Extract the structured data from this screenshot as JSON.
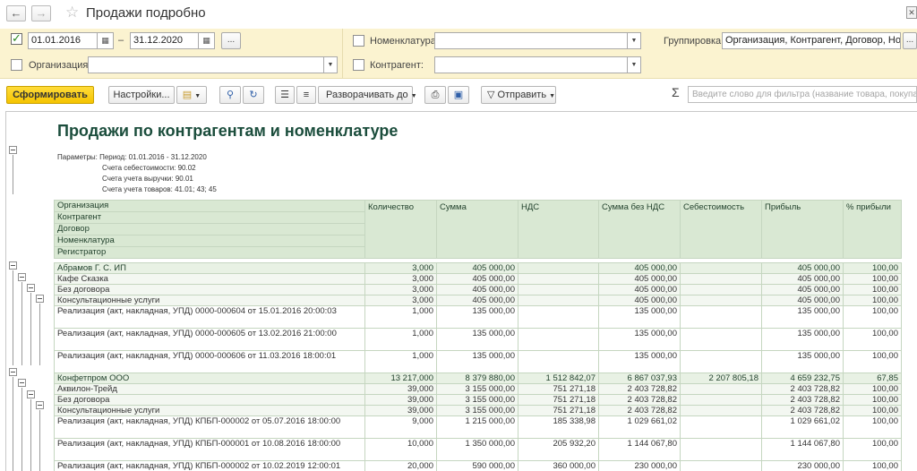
{
  "window": {
    "title": "Продажи подробно",
    "back_icon": "arrow-left",
    "forward_icon": "arrow-right",
    "favorite_icon": "star",
    "close_icon": "close"
  },
  "filters": {
    "period_from": "01.01.2016",
    "period_dash": "–",
    "period_to": "31.12.2020",
    "period_checked": true,
    "more_button": "...",
    "organization_label": "Организация:",
    "organization_value": "",
    "nomenclature_label": "Номенклатура:",
    "nomenclature_value": "",
    "counterparty_label": "Контрагент:",
    "counterparty_value": "",
    "grouping_label": "Группировка:",
    "grouping_value": "Организация, Контрагент, Договор, Номенклатура",
    "grouping_button": "..."
  },
  "toolbar": {
    "generate": "Сформировать",
    "settings": "Настройки...",
    "expand": "Разворачивать до",
    "send": "Отправить",
    "sigma": "Σ",
    "search_placeholder": "Введите слово для фильтра (название товара, покупателя)"
  },
  "report": {
    "title": "Продажи по контрагентам и номенклатуре",
    "params": [
      "Параметры: Период: 01.01.2016 - 31.12.2020",
      "Счета себестоимости: 90.02",
      "Счета учета выручки: 90.01",
      "Счета учета товаров: 41.01; 43; 45"
    ],
    "group_headers": [
      "Организация",
      "Контрагент",
      "Договор",
      "Номенклатура",
      "Регистратор"
    ],
    "columns": [
      "Количество",
      "Сумма",
      "НДС",
      "Сумма без НДС",
      "Себестоимость",
      "Прибыль",
      "% прибыли"
    ],
    "rows": [
      {
        "level": 1,
        "name": "Абрамов Г. С. ИП",
        "qty": "3,000",
        "sum": "405 000,00",
        "vat": "",
        "net": "405 000,00",
        "cost": "",
        "profit": "405 000,00",
        "pct": "100,00"
      },
      {
        "level": 2,
        "name": "Кафе Сказка",
        "qty": "3,000",
        "sum": "405 000,00",
        "vat": "",
        "net": "405 000,00",
        "cost": "",
        "profit": "405 000,00",
        "pct": "100,00"
      },
      {
        "level": 3,
        "name": "Без договора",
        "qty": "3,000",
        "sum": "405 000,00",
        "vat": "",
        "net": "405 000,00",
        "cost": "",
        "profit": "405 000,00",
        "pct": "100,00"
      },
      {
        "level": 4,
        "name": "Консультационные услуги",
        "qty": "3,000",
        "sum": "405 000,00",
        "vat": "",
        "net": "405 000,00",
        "cost": "",
        "profit": "405 000,00",
        "pct": "100,00"
      },
      {
        "level": 5,
        "name": "Реализация (акт, накладная, УПД) 0000-000604 от 15.01.2016 20:00:03",
        "qty": "1,000",
        "sum": "135 000,00",
        "vat": "",
        "net": "135 000,00",
        "cost": "",
        "profit": "135 000,00",
        "pct": "100,00"
      },
      {
        "level": 5,
        "name": "Реализация (акт, накладная, УПД) 0000-000605 от 13.02.2016 21:00:00",
        "qty": "1,000",
        "sum": "135 000,00",
        "vat": "",
        "net": "135 000,00",
        "cost": "",
        "profit": "135 000,00",
        "pct": "100,00"
      },
      {
        "level": 5,
        "name": "Реализация (акт, накладная, УПД) 0000-000606 от 11.03.2016 18:00:01",
        "qty": "1,000",
        "sum": "135 000,00",
        "vat": "",
        "net": "135 000,00",
        "cost": "",
        "profit": "135 000,00",
        "pct": "100,00"
      },
      {
        "level": 1,
        "name": "Конфетпром ООО",
        "qty": "13 217,000",
        "sum": "8 379 880,00",
        "vat": "1 512 842,07",
        "net": "6 867 037,93",
        "cost": "2 207 805,18",
        "profit": "4 659 232,75",
        "pct": "67,85"
      },
      {
        "level": 2,
        "name": "Аквилон-Трейд",
        "qty": "39,000",
        "sum": "3 155 000,00",
        "vat": "751 271,18",
        "net": "2 403 728,82",
        "cost": "",
        "profit": "2 403 728,82",
        "pct": "100,00"
      },
      {
        "level": 3,
        "name": "Без договора",
        "qty": "39,000",
        "sum": "3 155 000,00",
        "vat": "751 271,18",
        "net": "2 403 728,82",
        "cost": "",
        "profit": "2 403 728,82",
        "pct": "100,00"
      },
      {
        "level": 4,
        "name": "Консультационные услуги",
        "qty": "39,000",
        "sum": "3 155 000,00",
        "vat": "751 271,18",
        "net": "2 403 728,82",
        "cost": "",
        "profit": "2 403 728,82",
        "pct": "100,00"
      },
      {
        "level": 5,
        "name": "Реализация (акт, накладная, УПД) КПБП-000002 от 05.07.2016 18:00:00",
        "qty": "9,000",
        "sum": "1 215 000,00",
        "vat": "185 338,98",
        "net": "1 029 661,02",
        "cost": "",
        "profit": "1 029 661,02",
        "pct": "100,00"
      },
      {
        "level": 5,
        "name": "Реализация (акт, накладная, УПД) КПБП-000001 от 10.08.2016 18:00:00",
        "qty": "10,000",
        "sum": "1 350 000,00",
        "vat": "205 932,20",
        "net": "1 144 067,80",
        "cost": "",
        "profit": "1 144 067,80",
        "pct": "100,00"
      },
      {
        "level": 5,
        "name": "Реализация (акт, накладная, УПД) КПБП-000002 от 10.02.2019 12:00:01",
        "qty": "20,000",
        "sum": "590 000,00",
        "vat": "360 000,00",
        "net": "230 000,00",
        "cost": "",
        "profit": "230 000,00",
        "pct": "100,00"
      }
    ]
  }
}
